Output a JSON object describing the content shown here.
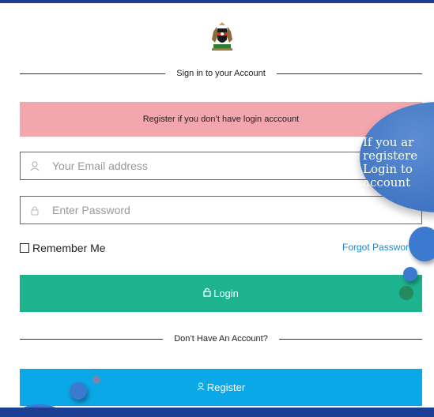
{
  "header": {
    "divider_text": "Sign in to your Account"
  },
  "alert": {
    "text": "Register if you don’t have login acccount"
  },
  "form": {
    "email_placeholder": "Your Email address",
    "password_placeholder": "Enter Password",
    "remember_label": "Remember Me",
    "forgot_label": "Forgot Passwor"
  },
  "buttons": {
    "login_label": "Login",
    "register_label": "Register"
  },
  "footer": {
    "divider_text": "Don’t Have An Account?"
  },
  "tooltip": {
    "text": "If you ar\nregistere\nLogin to\naccount"
  },
  "icons": {
    "logo": "coat-of-arms-logo",
    "email": "user-icon",
    "password": "lock-icon",
    "login": "unlock-icon",
    "register": "user-icon"
  },
  "colors": {
    "frame": "#1c3f94",
    "alert_bg": "#f4a6ae",
    "login_bg": "#1db38f",
    "register_bg": "#0aa8e6",
    "link": "#1e88d2",
    "bubble": "#3a6fbe"
  }
}
